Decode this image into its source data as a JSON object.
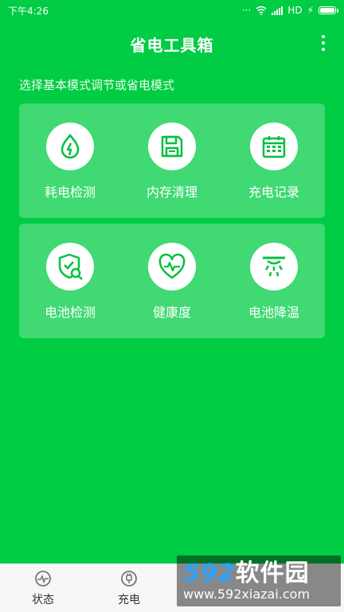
{
  "status_bar": {
    "time": "下午4:26",
    "dots": "···",
    "network": "HD"
  },
  "header": {
    "title": "省电工具箱",
    "menu_icon": "more-vertical-icon"
  },
  "subtitle": "选择基本模式调节或省电模式",
  "tools_row1": [
    {
      "label": "耗电检测",
      "icon": "power-drain-icon"
    },
    {
      "label": "内存清理",
      "icon": "floppy-disk-icon"
    },
    {
      "label": "充电记录",
      "icon": "calendar-icon"
    }
  ],
  "tools_row2": [
    {
      "label": "电池检测",
      "icon": "shield-search-icon"
    },
    {
      "label": "健康度",
      "icon": "heartbeat-icon"
    },
    {
      "label": "电池降温",
      "icon": "cooling-icon"
    }
  ],
  "bottom_nav": [
    {
      "label": "状态",
      "icon": "status-icon"
    },
    {
      "label": "充电",
      "icon": "plug-icon"
    }
  ],
  "watermark": {
    "brand_num": "592",
    "brand_text": "软件园",
    "url": "www.592xiazai.com"
  },
  "colors": {
    "background": "#00CC44",
    "card": "rgba(255,255,255,0.25)",
    "icon_green": "#00C040"
  }
}
